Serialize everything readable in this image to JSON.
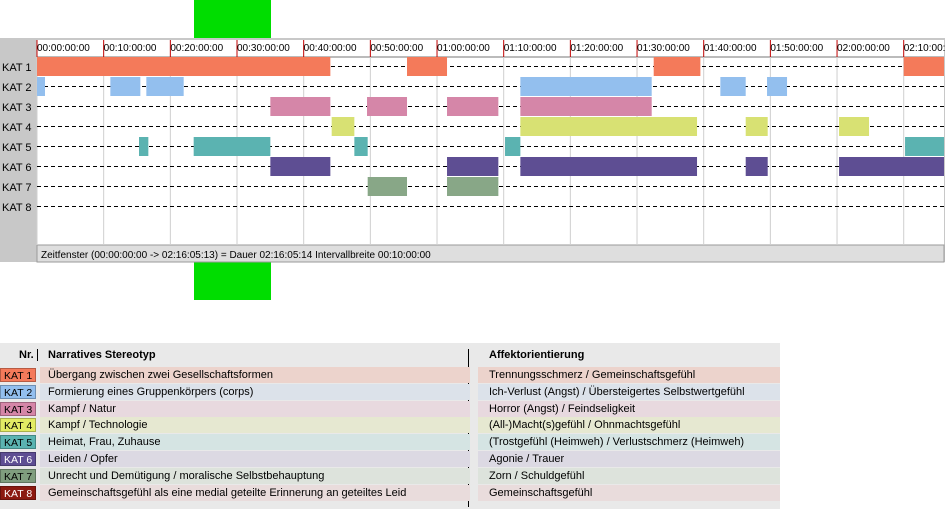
{
  "timeline": {
    "row_labels": [
      "KAT 1",
      "KAT 2",
      "KAT 3",
      "KAT 4",
      "KAT 5",
      "KAT 6",
      "KAT 7",
      "KAT 8"
    ],
    "tick_labels": [
      "00:00:00:00",
      "00:10:00:00",
      "00:20:00:00",
      "00:30:00:00",
      "00:40:00:00",
      "00:50:00:00",
      "01:00:00:00",
      "01:10:00:00",
      "01:20:00:00",
      "01:30:00:00",
      "01:40:00:00",
      "01:50:00:00",
      "02:00:00:00",
      "02:10:00:00"
    ],
    "status_text": "Zeitfenster (00:00:00:00 -> 02:16:05:13) = Dauer 02:16:05:14    Intervallbreite 00:10:00:00",
    "interval_minutes": 10,
    "total_minutes": 136.09
  },
  "chart_data": {
    "type": "gantt",
    "x_unit": "minutes",
    "xlim": [
      0,
      136.09
    ],
    "categories": [
      "KAT 1",
      "KAT 2",
      "KAT 3",
      "KAT 4",
      "KAT 5",
      "KAT 6",
      "KAT 7",
      "KAT 8"
    ],
    "colors": [
      "#f47a5a",
      "#93bfee",
      "#d586a8",
      "#d8e173",
      "#5bb3b1",
      "#5e4e93",
      "#88a787",
      "#8b1a10"
    ],
    "segments": [
      [
        [
          0,
          44
        ],
        [
          55.5,
          61.5
        ],
        [
          92.5,
          99.5
        ],
        [
          130,
          136.09
        ]
      ],
      [
        [
          0,
          1.2
        ],
        [
          11,
          15.5
        ],
        [
          16.4,
          22
        ],
        [
          72.5,
          92.2
        ],
        [
          102.5,
          106.3
        ],
        [
          109.5,
          112.5
        ]
      ],
      [
        [
          35,
          44
        ],
        [
          49.5,
          55.5
        ],
        [
          61.5,
          69.2
        ],
        [
          72.5,
          92.2
        ]
      ],
      [
        [
          44.2,
          47.6
        ],
        [
          72.5,
          99
        ],
        [
          106.3,
          109.6
        ],
        [
          120.3,
          124.8
        ]
      ],
      [
        [
          15.3,
          16.7
        ],
        [
          23.5,
          35
        ],
        [
          47.6,
          49.6
        ],
        [
          70.2,
          72.5
        ],
        [
          130.2,
          136.09
        ]
      ],
      [
        [
          35,
          44
        ],
        [
          61.5,
          69.2
        ],
        [
          72.5,
          99
        ],
        [
          106.3,
          109.6
        ],
        [
          120.3,
          136.09
        ]
      ],
      [
        [
          49.6,
          55.5
        ],
        [
          61.5,
          69.2
        ]
      ],
      []
    ]
  },
  "legend": {
    "header_nr": "Nr.",
    "header_stereotype": "Narratives Stereotyp",
    "header_affekt": "Affektorientierung",
    "rows": [
      {
        "nr": "KAT 1",
        "stereotype": "Übergang zwischen zwei Gesellschaftsformen",
        "affekt": "Trennungsschmerz / Gemeinschaftsgefühl",
        "color": "#f47a5a",
        "bg": "#ecd3cc",
        "text_color": "#000000"
      },
      {
        "nr": "KAT 2",
        "stereotype": "Formierung eines Gruppenkörpers (corps)",
        "affekt": "Ich-Verlust (Angst) / Übersteigertes Selbstwertgefühl",
        "color": "#93bfee",
        "bg": "#dce2ea",
        "text_color": "#000000"
      },
      {
        "nr": "KAT 3",
        "stereotype": "Kampf / Natur",
        "affekt": "Horror (Angst) / Feindseligkeit",
        "color": "#d586a8",
        "bg": "#e8d9df",
        "text_color": "#000000"
      },
      {
        "nr": "KAT 4",
        "stereotype": "Kampf / Technologie",
        "affekt": "(All-)Macht(s)gefühl / Ohnmachtsgefühl",
        "color": "#e3eb64",
        "bg": "#e6e8d1",
        "text_color": "#000000"
      },
      {
        "nr": "KAT 5",
        "stereotype": "Heimat, Frau, Zuhause",
        "affekt": "(Trostgefühl (Heimweh) / Verlustschmerz (Heimweh)",
        "color": "#5bb3b1",
        "bg": "#d5e4e3",
        "text_color": "#000000"
      },
      {
        "nr": "KAT 6",
        "stereotype": "Leiden / Opfer",
        "affekt": "Agonie / Trauer",
        "color": "#5e4e93",
        "bg": "#dcd9e3",
        "text_color": "#ffffff"
      },
      {
        "nr": "KAT 7",
        "stereotype": "Unrecht und Demütigung / moralische Selbstbehauptung",
        "affekt": "Zorn / Schuldgefühl",
        "color": "#7f9d7e",
        "bg": "#dde3dc",
        "text_color": "#000000"
      },
      {
        "nr": "KAT 8",
        "stereotype": "Gemeinschaftsgefühl als eine medial geteilte Erinnerung an geteiltes Leid",
        "affekt": "Gemeinschaftsgefühl",
        "color": "#8b1a10",
        "bg": "#e9dcdc",
        "text_color": "#ffffff"
      }
    ]
  }
}
